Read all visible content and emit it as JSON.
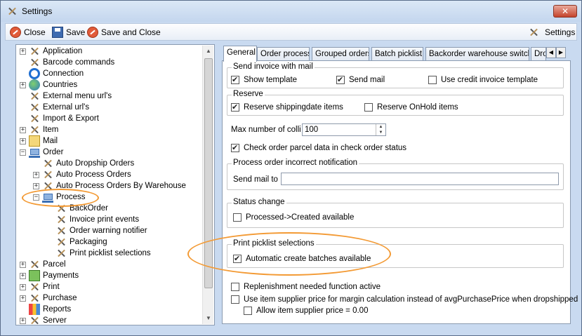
{
  "window": {
    "title": "Settings",
    "close_glyph": "✕"
  },
  "toolbar": {
    "close_label": "Close",
    "save_label": "Save",
    "save_close_label": "Save and Close",
    "settings_label": "Settings"
  },
  "tree": {
    "items": [
      {
        "label": "Application",
        "icon": "tools-icon",
        "expander": "+"
      },
      {
        "label": "Barcode commands",
        "icon": "tools-icon",
        "expander": ""
      },
      {
        "label": "Connection",
        "icon": "connection-icon",
        "expander": ""
      },
      {
        "label": "Countries",
        "icon": "globe-icon",
        "expander": "+"
      },
      {
        "label": "External menu url's",
        "icon": "tools-icon",
        "expander": ""
      },
      {
        "label": "External url's",
        "icon": "tools-icon",
        "expander": ""
      },
      {
        "label": "Import & Export",
        "icon": "tools-icon",
        "expander": ""
      },
      {
        "label": "Item",
        "icon": "tools-icon",
        "expander": "+"
      },
      {
        "label": "Mail",
        "icon": "mail-icon",
        "expander": "+"
      },
      {
        "label": "Order",
        "icon": "cart-icon",
        "expander": "−"
      },
      {
        "label": "Auto Dropship Orders",
        "icon": "tools-icon",
        "expander": ""
      },
      {
        "label": "Auto Process Orders",
        "icon": "tools-icon",
        "expander": "+"
      },
      {
        "label": "Auto Process Orders By Warehouse",
        "icon": "tools-icon",
        "expander": "+"
      },
      {
        "label": "Process",
        "icon": "cart-icon",
        "expander": "−"
      },
      {
        "label": "BackOrder",
        "icon": "tools-icon",
        "expander": ""
      },
      {
        "label": "Invoice print events",
        "icon": "tools-icon",
        "expander": ""
      },
      {
        "label": "Order warning notifier",
        "icon": "tools-icon",
        "expander": ""
      },
      {
        "label": "Packaging",
        "icon": "tools-icon",
        "expander": ""
      },
      {
        "label": "Print picklist selections",
        "icon": "tools-icon",
        "expander": ""
      },
      {
        "label": "Parcel",
        "icon": "tools-icon",
        "expander": "+"
      },
      {
        "label": "Payments",
        "icon": "money-icon",
        "expander": "+"
      },
      {
        "label": "Print",
        "icon": "tools-icon",
        "expander": "+"
      },
      {
        "label": "Purchase",
        "icon": "tools-icon",
        "expander": "+"
      },
      {
        "label": "Reports",
        "icon": "chart-icon",
        "expander": ""
      },
      {
        "label": "Server",
        "icon": "tools-icon",
        "expander": "+"
      }
    ]
  },
  "tabs": [
    "General",
    "Order process",
    "Grouped orders",
    "Batch picklist",
    "Backorder warehouse switch",
    "Dro"
  ],
  "tab_scroll": {
    "left": "◀",
    "right": "▶"
  },
  "scroll_arrows": {
    "up": "▲",
    "down": "▼"
  },
  "general": {
    "send_invoice": {
      "title": "Send invoice with mail",
      "show_template": "Show template",
      "send_mail": "Send mail",
      "use_credit": "Use credit invoice template"
    },
    "reserve": {
      "title": "Reserve",
      "shippingdate": "Reserve shippingdate items",
      "onhold": "Reserve OnHold items"
    },
    "max_colli_label": "Max number of colli",
    "max_colli_value": "100",
    "check_parcel": "Check order parcel data in check order status",
    "incorrect_notification": {
      "title": "Process order incorrect notification",
      "send_mail_to": "Send mail to",
      "send_mail_value": ""
    },
    "status_change": {
      "title": "Status change",
      "processed_created": "Processed->Created available"
    },
    "print_picklist": {
      "title": "Print picklist selections",
      "auto_batches": "Automatic create batches available"
    },
    "replenishment": "Replenishment needed function active",
    "use_supplier_price": "Use item supplier price for margin calculation instead of avgPurchasePrice when dropshipped",
    "allow_supplier_zero": "Allow item supplier price = 0.00"
  },
  "colors": {
    "highlight": "#f39a34",
    "titlebar": "#c9daf0"
  }
}
